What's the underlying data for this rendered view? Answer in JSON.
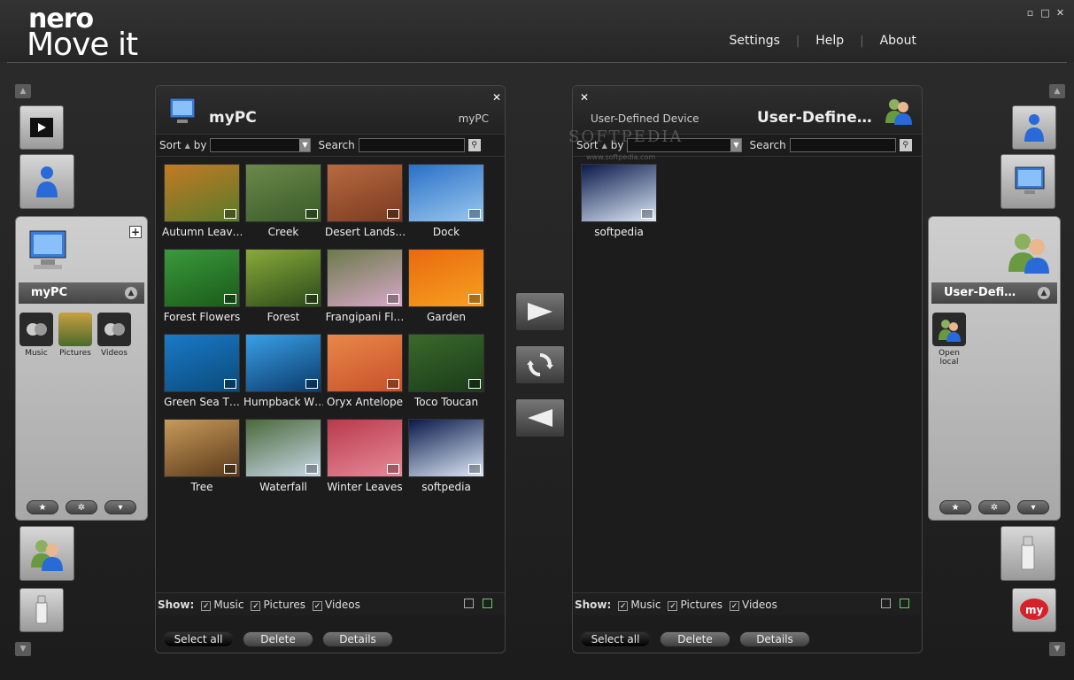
{
  "app": {
    "logo_top": "nero",
    "logo_bottom": "Move it"
  },
  "nav": {
    "settings": "Settings",
    "help": "Help",
    "about": "About",
    "sep": "|"
  },
  "window": {
    "minimize": "▫",
    "maximize": "□",
    "close": "✕"
  },
  "left_sidebar": {
    "panel_title": "myPC",
    "plus": "+",
    "shortcuts": [
      {
        "label": "Music",
        "icon": "music-icon"
      },
      {
        "label": "Pictures",
        "icon": "pictures-icon"
      },
      {
        "label": "Videos",
        "icon": "videos-icon"
      }
    ]
  },
  "right_sidebar": {
    "panel_title": "User-Defi…",
    "shortcuts": [
      {
        "label": "Open local",
        "icon": "users-icon"
      }
    ]
  },
  "left_panel": {
    "title": "myPC",
    "subtitle": "myPC",
    "close": "✕",
    "sort_label": "Sort",
    "by_label": "by",
    "search_label": "Search",
    "items": [
      {
        "caption": "Autumn Leav…",
        "color1": "#c27a24",
        "color2": "#5a7a2a"
      },
      {
        "caption": "Creek",
        "color1": "#6a8a4a",
        "color2": "#3a5a2a"
      },
      {
        "caption": "Desert Lands…",
        "color1": "#b86a40",
        "color2": "#7a3a20"
      },
      {
        "caption": "Dock",
        "color1": "#2a70c8",
        "color2": "#9ac8ee"
      },
      {
        "caption": "Forest Flowers",
        "color1": "#3a9a3a",
        "color2": "#1a5a1a"
      },
      {
        "caption": "Forest",
        "color1": "#8aaa3a",
        "color2": "#2a4a1a"
      },
      {
        "caption": "Frangipani  Fl…",
        "color1": "#6a7a4a",
        "color2": "#d8a8c8"
      },
      {
        "caption": "Garden",
        "color1": "#e86a10",
        "color2": "#f8a020"
      },
      {
        "caption": "Green Sea T…",
        "color1": "#1a7ac8",
        "color2": "#0a4a7a"
      },
      {
        "caption": "Humpback W…",
        "color1": "#3aa0e8",
        "color2": "#0a3a6a"
      },
      {
        "caption": "Oryx Antelope",
        "color1": "#e8884a",
        "color2": "#c8502a"
      },
      {
        "caption": "Toco Toucan",
        "color1": "#3a6a2a",
        "color2": "#1a3a1a"
      },
      {
        "caption": "Tree",
        "color1": "#c89a5a",
        "color2": "#5a3a1a"
      },
      {
        "caption": "Waterfall",
        "color1": "#4a6a3a",
        "color2": "#c8d8e8"
      },
      {
        "caption": "Winter Leaves",
        "color1": "#b83a4a",
        "color2": "#e88a9a"
      },
      {
        "caption": "softpedia",
        "color1": "#0a1a4a",
        "color2": "#dde8f8"
      }
    ],
    "show_label": "Show:",
    "music": "Music",
    "pictures": "Pictures",
    "videos": "Videos",
    "select_all": "Select all",
    "delete": "Delete",
    "details": "Details"
  },
  "right_panel": {
    "title": "User-Define…",
    "subtitle": "User-Defined Device",
    "close": "✕",
    "sort_label": "Sort",
    "by_label": "by",
    "search_label": "Search",
    "items": [
      {
        "caption": "softpedia",
        "color1": "#0a1a4a",
        "color2": "#dde8f8"
      }
    ],
    "show_label": "Show:",
    "music": "Music",
    "pictures": "Pictures",
    "videos": "Videos",
    "select_all": "Select all",
    "delete": "Delete",
    "details": "Details"
  },
  "watermark": {
    "text": "SOFTPEDIA",
    "url": "www.softpedia.com"
  },
  "checkmark": "✓"
}
